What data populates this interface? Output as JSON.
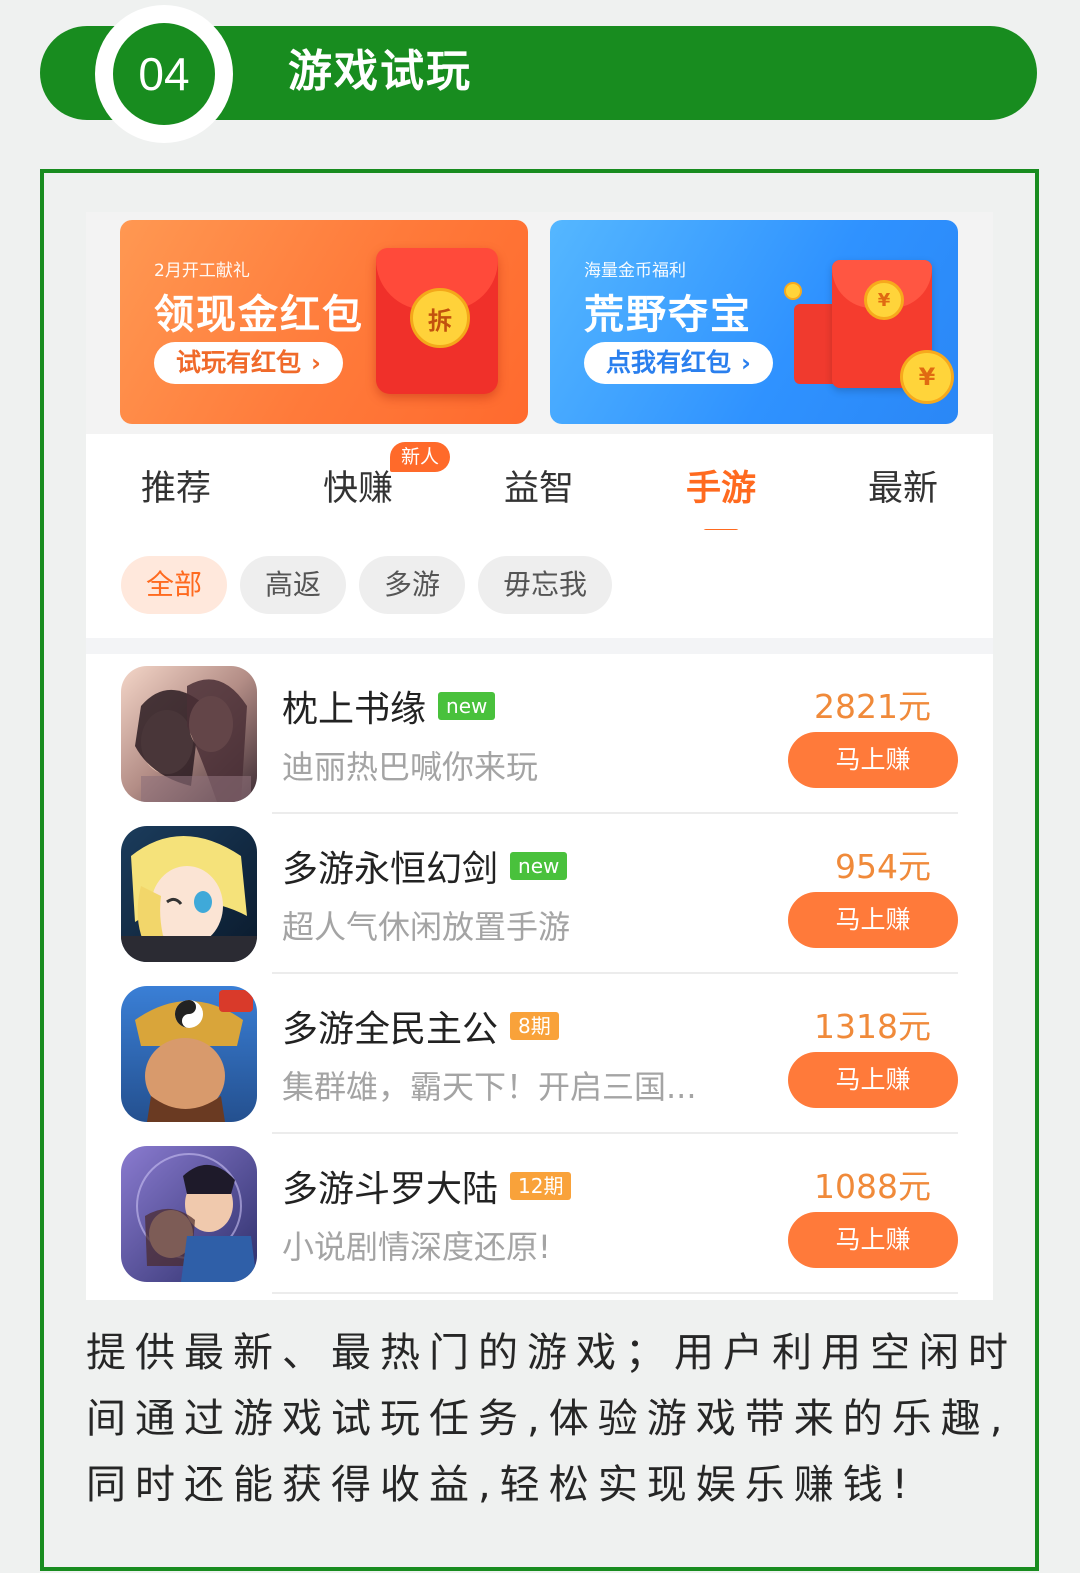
{
  "header": {
    "number": "04",
    "title": "游戏试玩"
  },
  "banners": [
    {
      "small": "2月开工献礼",
      "big": "领现金红包",
      "button": "试玩有红包",
      "chevron": "›",
      "envelope_char": "拆"
    },
    {
      "small": "海量金币福利",
      "big": "荒野夺宝",
      "button": "点我有红包",
      "chevron": "›",
      "coin_char": "¥"
    }
  ],
  "tabs": [
    {
      "label": "推荐",
      "active": false
    },
    {
      "label": "快赚",
      "active": false,
      "badge": "新人"
    },
    {
      "label": "益智",
      "active": false
    },
    {
      "label": "手游",
      "active": true
    },
    {
      "label": "最新",
      "active": false
    }
  ],
  "chips": [
    {
      "label": "全部",
      "active": true
    },
    {
      "label": "高返",
      "active": false
    },
    {
      "label": "多游",
      "active": false
    },
    {
      "label": "毋忘我",
      "active": false
    }
  ],
  "games": [
    {
      "title": "枕上书缘",
      "tag": "new",
      "subtitle": "迪丽热巴喊你来玩",
      "amount": "2821元",
      "button": "马上赚"
    },
    {
      "title": "多游永恒幻剑",
      "tag": "new",
      "subtitle": "超人气休闲放置手游",
      "amount": "954元",
      "button": "马上赚"
    },
    {
      "title": "多游全民主公",
      "tag": "8期",
      "subtitle": "集群雄，霸天下！开启三国...",
      "amount": "1318元",
      "button": "马上赚"
    },
    {
      "title": "多游斗罗大陆",
      "tag": "12期",
      "subtitle": "小说剧情深度还原!",
      "amount": "1088元",
      "button": "马上赚"
    }
  ],
  "description": {
    "line1": "提供最新、最热门的游戏；用户利用空闲时",
    "line2": "间通过游戏试玩任务,体验游戏带来的乐趣,",
    "line3": "同时还能获得收益,轻松实现娱乐赚钱!"
  },
  "colors": {
    "brand_green": "#188c1f",
    "accent_orange": "#ff6a1f",
    "amount_orange": "#f08a3a"
  }
}
